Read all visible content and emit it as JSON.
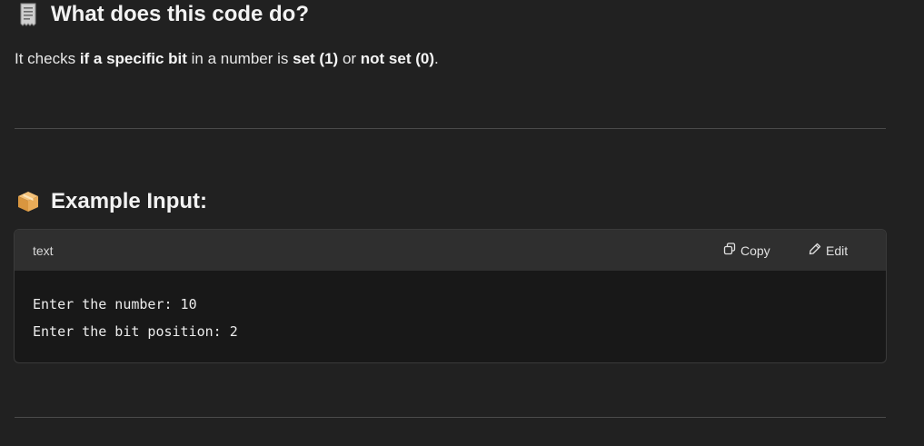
{
  "section1": {
    "icon": "receipt-icon",
    "title": "What does this code do?",
    "paragraph": {
      "t1": "It checks ",
      "b1": "if a specific bit",
      "t2": " in a number is ",
      "b2": "set (1)",
      "t3": " or ",
      "b3": "not set (0)",
      "t4": "."
    }
  },
  "section2": {
    "icon": "package-icon",
    "title": "Example Input:"
  },
  "code_block": {
    "language": "text",
    "copy_label": "Copy",
    "edit_label": "Edit",
    "lines": [
      "Enter the number: 10",
      "Enter the bit position: 2"
    ]
  },
  "colors": {
    "background": "#212121",
    "code_header": "#2f2f2f",
    "code_body": "#181818"
  }
}
